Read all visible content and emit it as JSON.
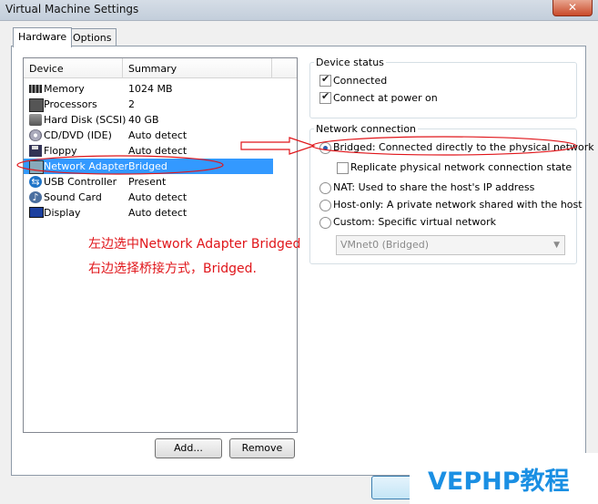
{
  "window": {
    "title": "Virtual Machine Settings",
    "close_glyph": "✕"
  },
  "tabs": [
    {
      "label": "Hardware",
      "active": true
    },
    {
      "label": "Options",
      "active": false
    }
  ],
  "device_list": {
    "header_device": "Device",
    "header_summary": "Summary",
    "rows": [
      {
        "icon": "memory-icon",
        "name": "Memory",
        "summary": "1024 MB"
      },
      {
        "icon": "processor-icon",
        "name": "Processors",
        "summary": "2"
      },
      {
        "icon": "hard-disk-icon",
        "name": "Hard Disk (SCSI)",
        "summary": "40 GB"
      },
      {
        "icon": "cd-dvd-icon",
        "name": "CD/DVD (IDE)",
        "summary": "Auto detect"
      },
      {
        "icon": "floppy-icon",
        "name": "Floppy",
        "summary": "Auto detect"
      },
      {
        "icon": "network-adapter-icon",
        "name": "Network Adapter",
        "summary": "Bridged",
        "selected": true
      },
      {
        "icon": "usb-icon",
        "name": "USB Controller",
        "summary": "Present"
      },
      {
        "icon": "sound-card-icon",
        "name": "Sound Card",
        "summary": "Auto detect"
      },
      {
        "icon": "display-icon",
        "name": "Display",
        "summary": "Auto detect"
      }
    ]
  },
  "buttons": {
    "add": "Add...",
    "remove": "Remove"
  },
  "device_status": {
    "title": "Device status",
    "connected": "Connected",
    "connect_at_power_on": "Connect at power on"
  },
  "network_connection": {
    "title": "Network connection",
    "bridged": "Bridged: Connected directly to the physical network",
    "replicate": "Replicate physical network connection state",
    "nat": "NAT: Used to share the host's IP address",
    "host_only": "Host-only: A private network shared with the host",
    "custom": "Custom: Specific virtual network",
    "custom_select_value": "VMnet0 (Bridged)",
    "selected": "bridged"
  },
  "annotations": {
    "line1": "左边选中Network Adapter Bridged",
    "line2": "右边选择桥接方式，Bridged."
  },
  "watermark": "VEPHP教程",
  "colors": {
    "selection": "#3399ff",
    "annotation": "#e0151a",
    "watermark": "#1a8fe3"
  }
}
